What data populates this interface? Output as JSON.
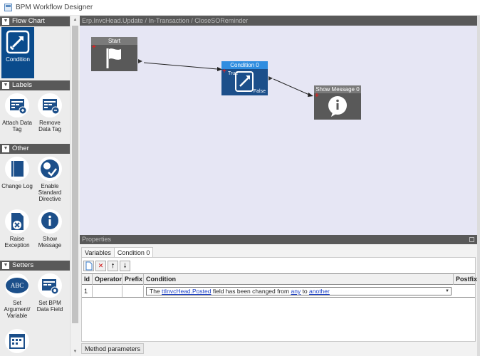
{
  "window": {
    "title": "BPM Workflow Designer"
  },
  "sidebar": {
    "sections": [
      {
        "title": "Flow Chart",
        "items": [
          {
            "label": "Condition",
            "icon": "condition-icon",
            "selected": true
          }
        ]
      },
      {
        "title": "Labels",
        "items": [
          {
            "label": "Attach Data Tag",
            "icon": "attach-data-tag-icon"
          },
          {
            "label": "Remove Data Tag",
            "icon": "remove-data-tag-icon"
          }
        ]
      },
      {
        "title": "Other",
        "items": [
          {
            "label": "Change Log",
            "icon": "change-log-icon"
          },
          {
            "label": "Enable Standard Directive",
            "icon": "enable-standard-directive-icon"
          },
          {
            "label": "Raise Exception",
            "icon": "raise-exception-icon"
          },
          {
            "label": "Show Message",
            "icon": "show-message-icon"
          }
        ]
      },
      {
        "title": "Setters",
        "items": [
          {
            "label": "Set Argument/ Variable",
            "icon": "abc-icon"
          },
          {
            "label": "Set BPM Data Field",
            "icon": "set-bpm-data-field-icon"
          },
          {
            "label": "",
            "icon": "calendar-icon"
          }
        ]
      }
    ]
  },
  "designer": {
    "path": "Erp.InvcHead.Update / In-Transaction / CloseSOReminder",
    "nodes": {
      "start": {
        "title": "Start"
      },
      "condition": {
        "title": "Condition 0",
        "true_label": "True",
        "false_label": "False"
      },
      "message": {
        "title": "Show Message 0"
      }
    }
  },
  "properties": {
    "header": "Properties",
    "tabs": [
      "Variables",
      "Condition 0"
    ],
    "active_tab": "Condition 0",
    "grid": {
      "columns": [
        "Id",
        "Operator",
        "Prefix",
        "Condition",
        "Postfix"
      ],
      "rows": [
        {
          "id": "1",
          "operator": "",
          "prefix": "",
          "condition": {
            "before": "The ",
            "field": "ttInvcHead.Posted",
            "middle": " field has been changed from ",
            "from": "any",
            "to_word": " to ",
            "to": "another"
          },
          "postfix": ""
        }
      ]
    },
    "bottom_tab": "Method parameters"
  },
  "colors": {
    "accent": "#0a4b8c",
    "condition_header": "#2f8de0",
    "canvas": "#e6e6f4",
    "panel_header": "#595959"
  }
}
